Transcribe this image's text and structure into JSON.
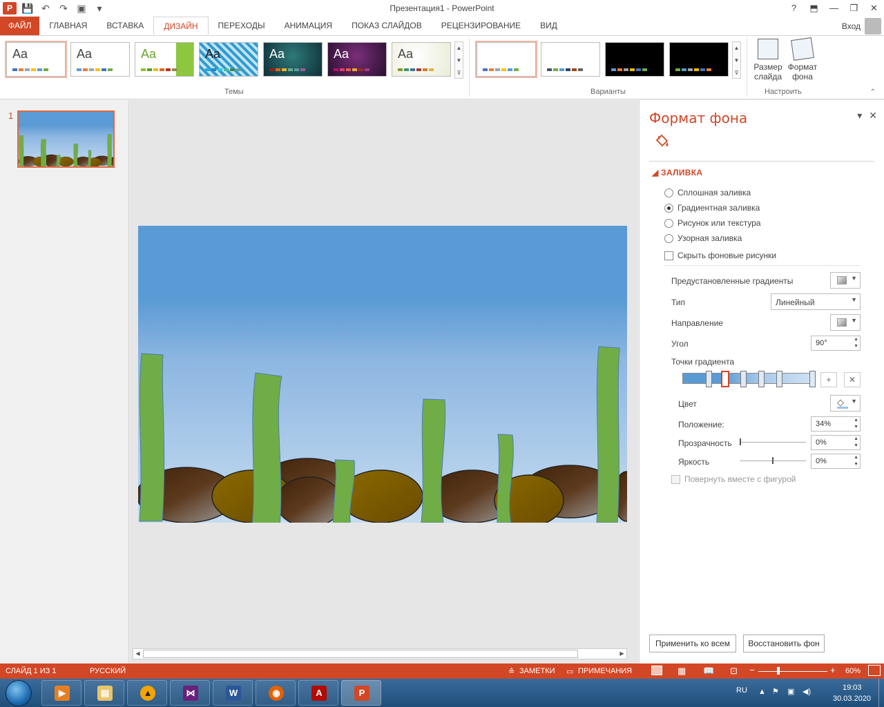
{
  "window": {
    "title": "Презентация1 - PowerPoint",
    "help": "?",
    "signin": "Вход"
  },
  "tabs": [
    "ФАЙЛ",
    "ГЛАВНАЯ",
    "ВСТАВКА",
    "ДИЗАЙН",
    "ПЕРЕХОДЫ",
    "АНИМАЦИЯ",
    "ПОКАЗ СЛАЙДОВ",
    "РЕЦЕНЗИРОВАНИЕ",
    "ВИД"
  ],
  "active_tab": "ДИЗАЙН",
  "ribbon": {
    "themes_label": "Темы",
    "variants_label": "Варианты",
    "customize_label": "Настроить",
    "theme_sample": "Aa",
    "slide_size_label": "Размер слайда",
    "format_bg_label": "Формат фона"
  },
  "thumbnail": {
    "number": "1"
  },
  "format_pane": {
    "title": "Формат фона",
    "section": "ЗАЛИВКА",
    "fill_options": [
      "Сплошная заливка",
      "Градиентная заливка",
      "Рисунок или текстура",
      "Узорная заливка"
    ],
    "selected_fill": "Градиентная заливка",
    "hide_bg": "Скрыть фоновые рисунки",
    "preset_label": "Предустановленные градиенты",
    "type_label": "Тип",
    "type_value": "Линейный",
    "direction_label": "Направление",
    "angle_label": "Угол",
    "angle_value": "90°",
    "stops_label": "Точки градиента",
    "color_label": "Цвет",
    "position_label": "Положение:",
    "position_value": "34%",
    "transparency_label": "Прозрачность",
    "transparency_value": "0%",
    "brightness_label": "Яркость",
    "brightness_value": "0%",
    "rotate_with_shape": "Повернуть вместе с фигурой",
    "apply_all": "Применить ко всем",
    "reset_bg": "Восстановить фон"
  },
  "status": {
    "slide_info": "СЛАЙД 1 ИЗ 1",
    "language": "РУССКИЙ",
    "notes": "ЗАМЕТКИ",
    "comments": "ПРИМЕЧАНИЯ",
    "zoom": "60%"
  },
  "taskbar": {
    "lang": "RU",
    "time": "19:03",
    "date": "30.03.2020"
  },
  "colors": {
    "accent": "#d24726",
    "sky_top": "#5b9bd5",
    "sky_bottom": "#c5dcf0",
    "grass": "#70ad47",
    "stone_dark": "#4a2a10",
    "stone_gold": "#7f6000"
  }
}
